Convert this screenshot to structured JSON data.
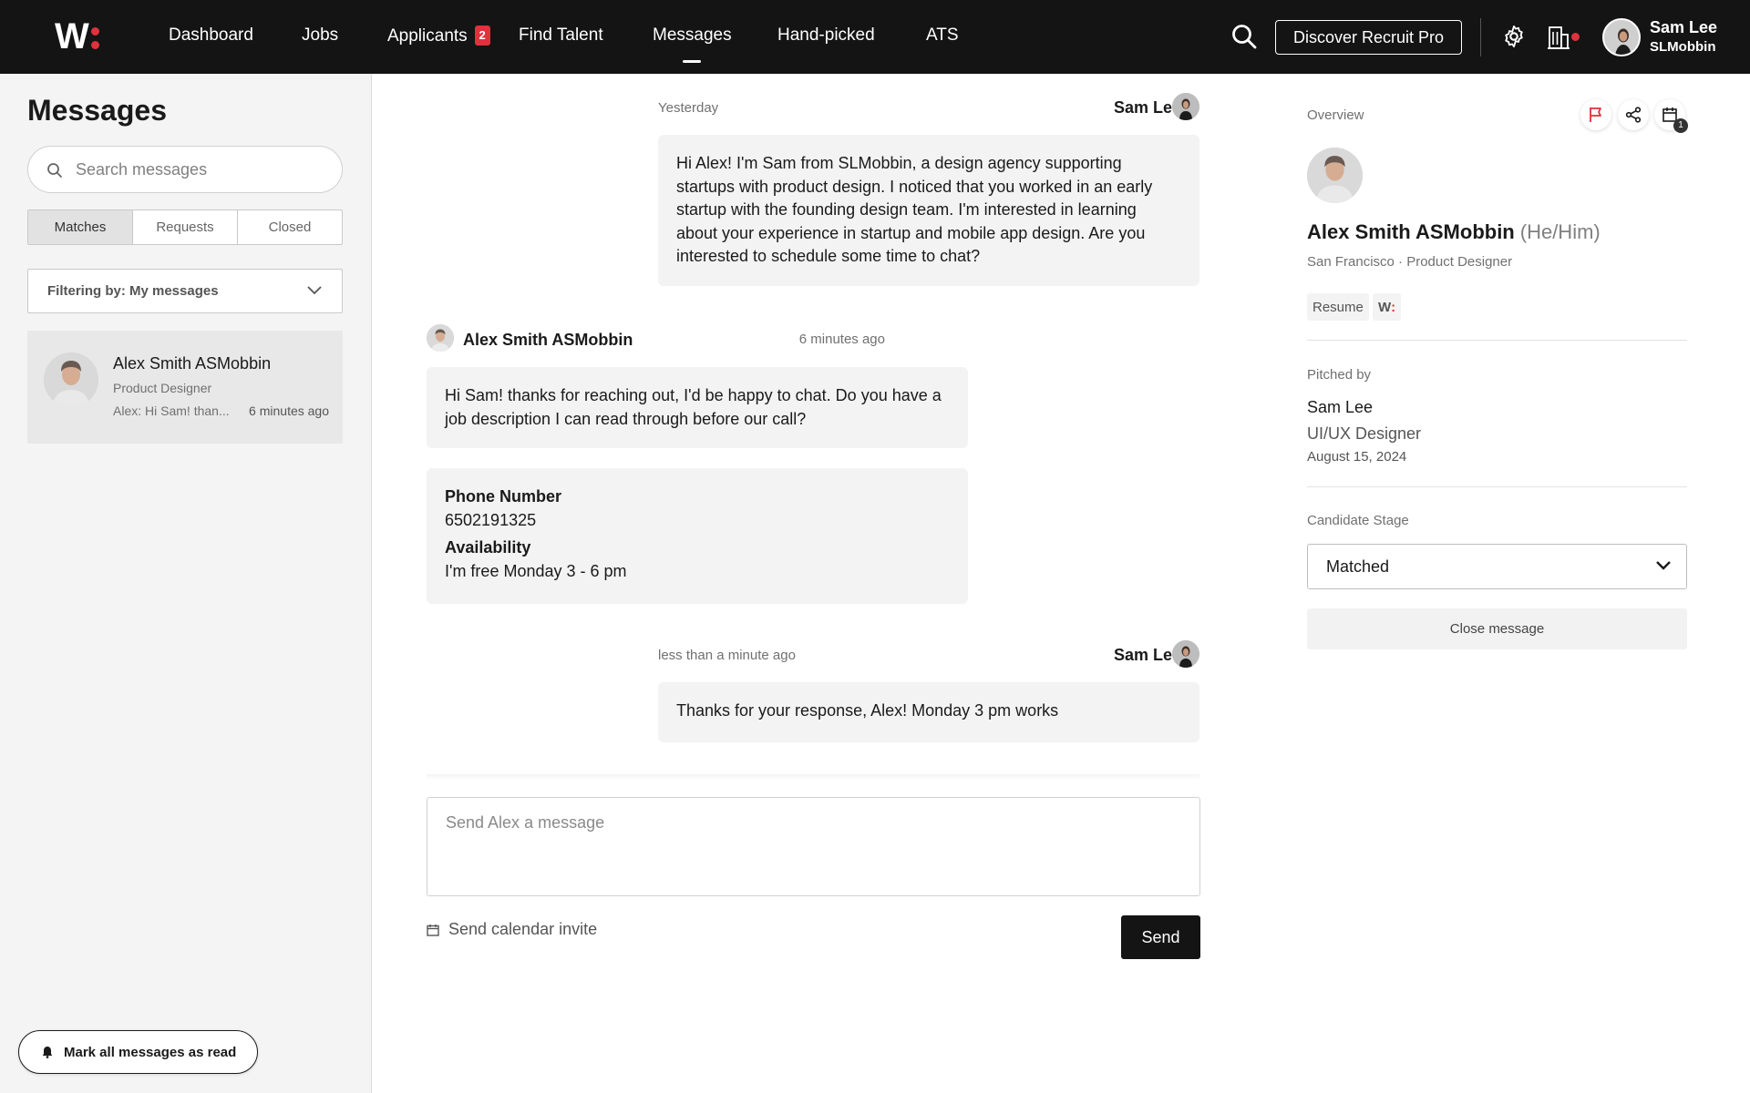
{
  "nav": {
    "items": [
      {
        "label": "Dashboard"
      },
      {
        "label": "Jobs"
      },
      {
        "label": "Applicants",
        "badge": "2"
      },
      {
        "label": "Find Talent"
      },
      {
        "label": "Messages"
      },
      {
        "label": "Hand-picked"
      },
      {
        "label": "ATS"
      }
    ],
    "active": "Messages",
    "cta_label": "Discover Recruit Pro",
    "user": {
      "name": "Sam Lee",
      "company": "SLMobbin"
    },
    "accent_color": "#e0313c"
  },
  "sidebar": {
    "title": "Messages",
    "search_placeholder": "Search messages",
    "tabs": [
      "Matches",
      "Requests",
      "Closed"
    ],
    "active_tab": "Matches",
    "filter_label": "Filtering by: My messages",
    "conversations": [
      {
        "name": "Alex Smith ASMobbin",
        "role": "Product Designer",
        "preview": "Alex: Hi Sam! than...",
        "time": "6 minutes ago"
      }
    ],
    "mark_all_label": "Mark all messages as read"
  },
  "chat": {
    "messages": [
      {
        "timestamp": "Yesterday",
        "sender": "Sam Lee",
        "text": "Hi Alex! I'm Sam from SLMobbin, a design agency supporting startups with product design. I noticed that you worked in an early startup with the founding design team. I'm interested in learning about your experience in startup and mobile app design. Are you interested to schedule some time to chat?"
      },
      {
        "timestamp": "6 minutes ago",
        "sender": "Alex Smith ASMobbin",
        "text": "Hi Sam! thanks for reaching out, I'd be happy to chat. Do you have a job description I can read through before our call?",
        "details": {
          "phone_label": "Phone Number",
          "phone": "6502191325",
          "availability_label": "Availability",
          "availability": "I'm free Monday 3 - 6 pm"
        }
      },
      {
        "timestamp": "less than a minute ago",
        "sender": "Sam Lee",
        "text": "Thanks for your response, Alex! Monday 3 pm works"
      }
    ],
    "composer_placeholder": "Send Alex a message",
    "calendar_invite_label": "Send calendar invite",
    "send_label": "Send"
  },
  "panel": {
    "overview_label": "Overview",
    "calendar_count": "1",
    "candidate": {
      "name": "Alex Smith ASMobbin",
      "pronouns": "(He/Him)",
      "subtitle": "San Francisco · Product Designer"
    },
    "resume_label": "Resume",
    "wellfound_mark": "W",
    "pitched_label": "Pitched by",
    "pitched_by": {
      "name": "Sam Lee",
      "role": "UI/UX Designer",
      "date": "August 15, 2024"
    },
    "stage_label": "Candidate Stage",
    "stage_value": "Matched",
    "close_label": "Close message"
  }
}
